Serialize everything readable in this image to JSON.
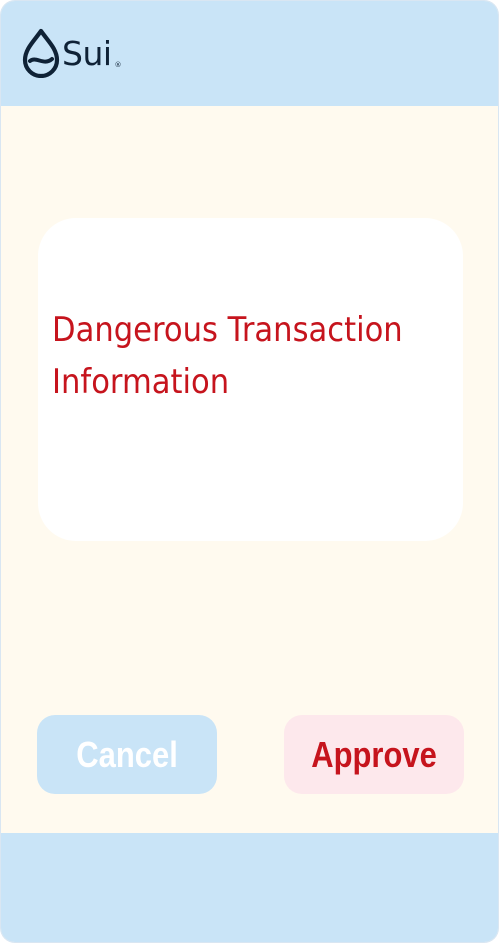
{
  "header": {
    "logo_text": "Sui",
    "logo_registered": "®",
    "logo_icon": "sui-droplet-icon",
    "background": "#c9e4f7"
  },
  "card": {
    "warning_text": "Dangerous Transaction Information",
    "warning_color": "#c6141d"
  },
  "actions": {
    "cancel_label": "Cancel",
    "approve_label": "Approve"
  },
  "colors": {
    "page_background": "#fffaef",
    "header_footer": "#c9e4f7",
    "cancel_button": "#c9e4f7",
    "approve_button": "#fde8ec",
    "danger": "#c6141d"
  }
}
